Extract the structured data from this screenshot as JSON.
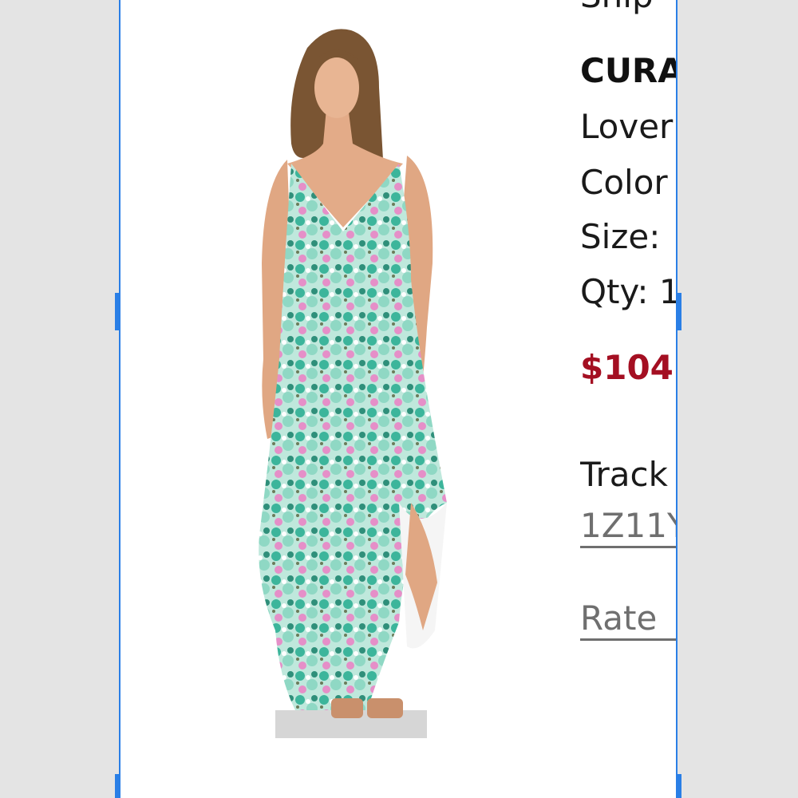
{
  "order_item": {
    "status_partial": "Ship",
    "brand_partial": "CURA",
    "name_partial": "Lover",
    "color_partial": "Color",
    "size_partial": "Size:",
    "qty_partial": "Qty: 1",
    "price_partial": "$104",
    "tracking_label_partial": "Track",
    "tracking_number_partial": "1Z11Y",
    "rate_link_partial": "Rate"
  },
  "colors": {
    "price": "#a40f22",
    "selection": "#2a7fe6",
    "link": "#6f6f6f"
  }
}
